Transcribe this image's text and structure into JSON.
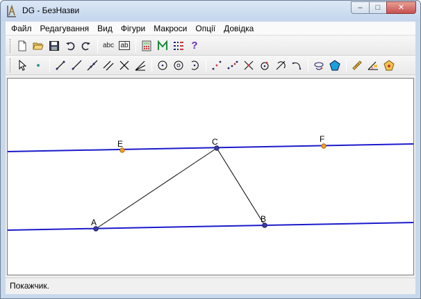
{
  "window": {
    "title": "DG - БезНазви",
    "minimize": "–",
    "maximize": "□",
    "close": "✕"
  },
  "menu": [
    "Файл",
    "Редагування",
    "Вид",
    "Фігури",
    "Макроси",
    "Опції",
    "Довідка"
  ],
  "toolbar1": {
    "icons": [
      "new-file-icon",
      "open-folder-icon",
      "save-disk-icon",
      "undo-icon",
      "redo-icon",
      "text-label-icon",
      "text-edit-icon",
      "calculator-icon",
      "macro-m-icon",
      "equation-icon",
      "help-icon"
    ],
    "text_label": "abc",
    "text_edit": "ab",
    "help": "?"
  },
  "toolbar2": {
    "icons": [
      "pointer-icon",
      "point-icon",
      "segment-icon",
      "ray-icon",
      "line-icon",
      "parallel-icon",
      "perpendicular-icon",
      "angle-bisector-icon",
      "circle-icon",
      "circle-radius-icon",
      "arc-icon",
      "midpoint-icon",
      "divide-point-icon",
      "intersection-icon",
      "point-on-circle-icon",
      "tangent-icon",
      "arc-three-points-icon",
      "transform-icon",
      "polygon-icon",
      "measure-icon",
      "angle-measure-icon",
      "regular-polygon-icon"
    ]
  },
  "points": [
    {
      "name": "A",
      "color": "#3b3ba8"
    },
    {
      "name": "B",
      "color": "#3b3ba8"
    },
    {
      "name": "C",
      "color": "#3b3ba8"
    },
    {
      "name": "E",
      "color": "#f0a020"
    },
    {
      "name": "F",
      "color": "#f0a020"
    }
  ],
  "colors": {
    "line": "#1a1acc",
    "segment": "#000000"
  },
  "status": {
    "text": "Покажчик."
  }
}
